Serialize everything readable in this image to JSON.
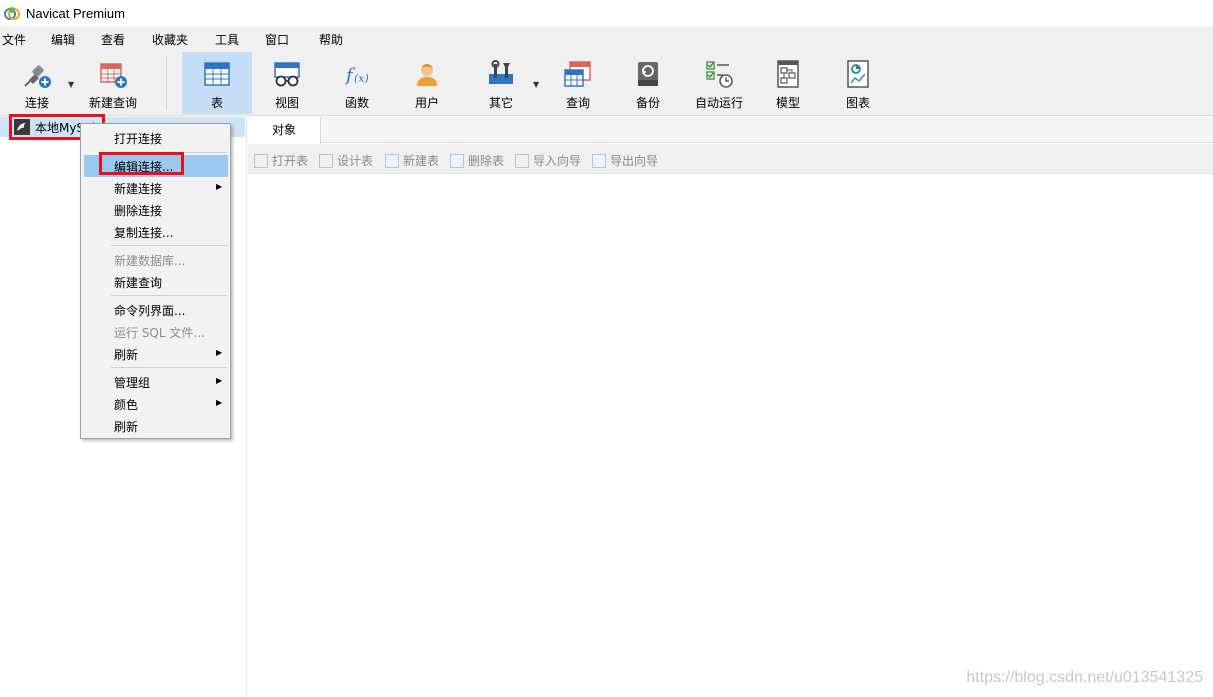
{
  "window": {
    "title": "Navicat Premium"
  },
  "menubar": {
    "items": [
      "文件",
      "编辑",
      "查看",
      "收藏夹",
      "工具",
      "窗口",
      "帮助"
    ]
  },
  "toolbar": {
    "buttons": [
      {
        "label": "连接",
        "icon": "connect-plug-icon"
      },
      {
        "label": "新建查询",
        "icon": "new-query-icon"
      },
      {
        "label": "表",
        "icon": "table-icon",
        "active": true
      },
      {
        "label": "视图",
        "icon": "view-glasses-icon"
      },
      {
        "label": "函数",
        "icon": "function-fx-icon"
      },
      {
        "label": "用户",
        "icon": "user-icon"
      },
      {
        "label": "其它",
        "icon": "tools-icon"
      },
      {
        "label": "查询",
        "icon": "query-icon"
      },
      {
        "label": "备份",
        "icon": "backup-icon"
      },
      {
        "label": "自动运行",
        "icon": "auto-run-icon"
      },
      {
        "label": "模型",
        "icon": "model-icon"
      },
      {
        "label": "图表",
        "icon": "chart-icon"
      }
    ]
  },
  "tree": {
    "connection_label": "本地MySql"
  },
  "tabs": {
    "objects_label": "对象"
  },
  "object_toolbar": {
    "buttons": [
      "打开表",
      "设计表",
      "新建表",
      "删除表",
      "导入向导",
      "导出向导"
    ]
  },
  "context_menu": {
    "items": [
      {
        "label": "打开连接",
        "enabled": true
      },
      {
        "label": "编辑连接...",
        "enabled": true,
        "highlighted": true
      },
      {
        "label": "新建连接",
        "enabled": true,
        "submenu": true
      },
      {
        "label": "删除连接",
        "enabled": true
      },
      {
        "label": "复制连接...",
        "enabled": true
      },
      {
        "label": "新建数据库...",
        "enabled": false
      },
      {
        "label": "新建查询",
        "enabled": true
      },
      {
        "label": "命令列界面...",
        "enabled": true
      },
      {
        "label": "运行 SQL 文件...",
        "enabled": false
      },
      {
        "label": "刷新",
        "enabled": true,
        "submenu": true
      },
      {
        "label": "管理组",
        "enabled": true,
        "submenu": true
      },
      {
        "label": "颜色",
        "enabled": true,
        "submenu": true
      },
      {
        "label": "刷新",
        "enabled": true
      }
    ]
  },
  "watermark": "https://blog.csdn.net/u013541325",
  "colors": {
    "highlight": "#99c9ef",
    "selection": "#cce4f7",
    "annotation_red": "#e8101c"
  }
}
